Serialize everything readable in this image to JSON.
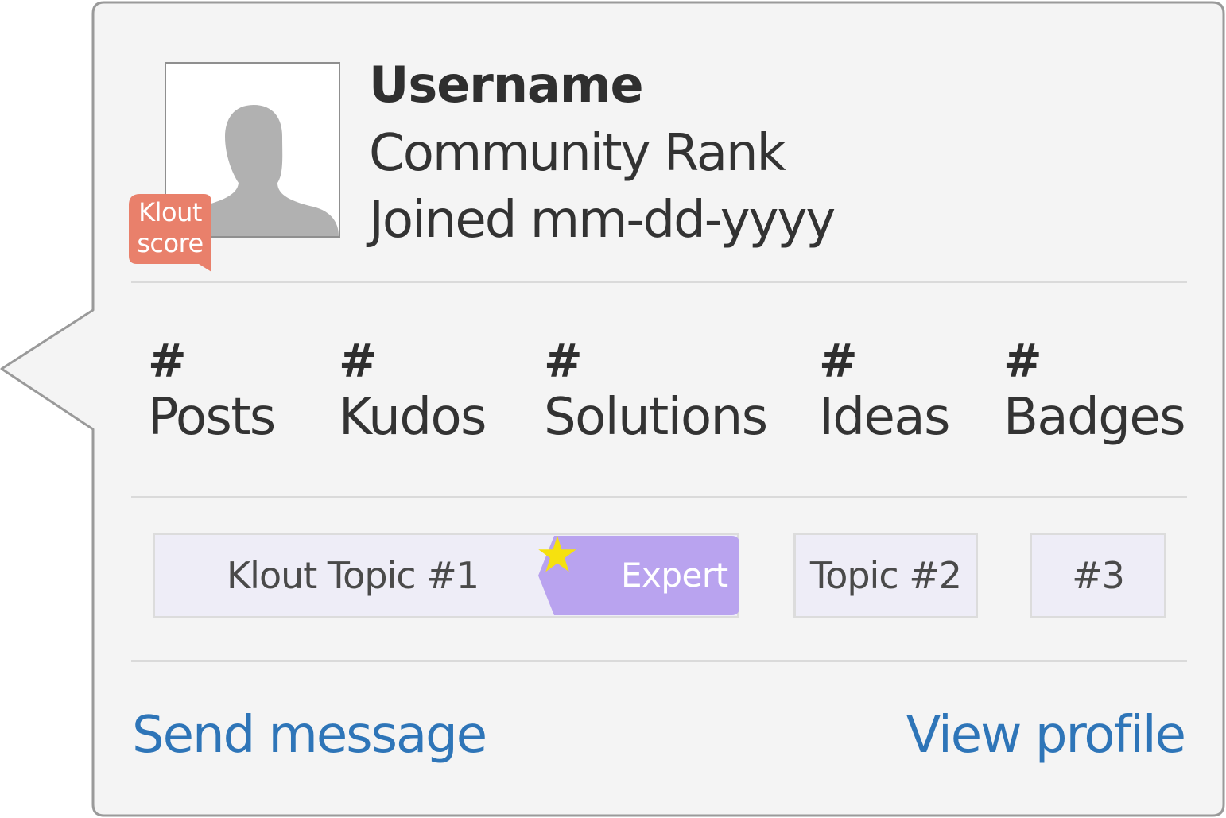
{
  "user": {
    "username": "Username",
    "rank": "Community Rank",
    "joined": "Joined mm-dd-yyyy",
    "klout_badge": "Klout score"
  },
  "stats": [
    {
      "value": "#",
      "label": "Posts"
    },
    {
      "value": "#",
      "label": "Kudos"
    },
    {
      "value": "#",
      "label": "Solutions"
    },
    {
      "value": "#",
      "label": "Ideas"
    },
    {
      "value": "#",
      "label": "Badges"
    }
  ],
  "topics": [
    {
      "label": "Klout Topic #1",
      "tag": "Expert"
    },
    {
      "label": "Topic #2"
    },
    {
      "label": "#3"
    }
  ],
  "actions": {
    "send_message": "Send message",
    "view_profile": "View profile"
  },
  "icons": {
    "avatar": "person-silhouette-icon",
    "expert": "star-icon"
  },
  "colors": {
    "card_background": "#f4f4f4",
    "card_border": "#9a9a9a",
    "klout_badge": "#e9806b",
    "expert_tag": "#b9a3ef",
    "star": "#f6e10f",
    "link": "#2e75b8",
    "topic_background": "#eeedf7"
  }
}
